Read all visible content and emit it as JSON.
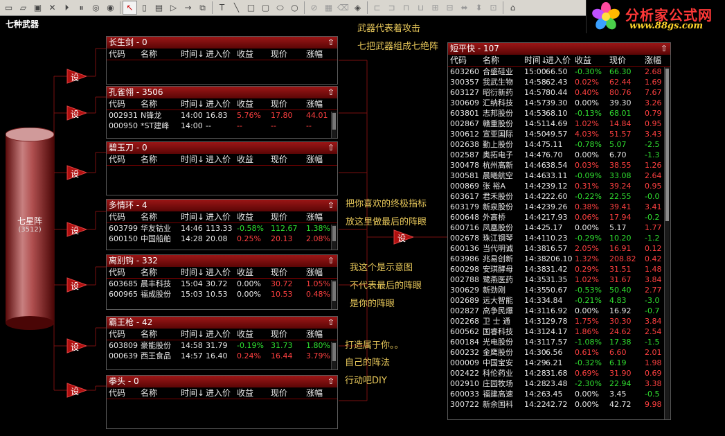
{
  "toolbar": {
    "icons": [
      "new-icon",
      "open-icon",
      "save-icon",
      "delete-icon",
      "play-icon",
      "pause-icon",
      "stop-icon",
      "record-icon",
      "select-arrow-icon",
      "rect-frame-icon",
      "note-icon",
      "triangle-icon",
      "arrow-line-icon",
      "copy-icon",
      "text-icon",
      "line-icon",
      "rectangle-icon",
      "rounded-rect-icon",
      "ellipse-icon",
      "circle-icon",
      "disabled-icon",
      "paste-icon",
      "trash-icon",
      "fill-icon",
      "align-left-icon",
      "align-right-icon",
      "align-top-icon",
      "align-bottom-icon",
      "align-center-icon",
      "distribute-icon",
      "same-width-icon",
      "same-height-icon",
      "same-size-icon",
      "layout-icon"
    ]
  },
  "logo": {
    "title": "分析家公式网",
    "url": "www.88gs.com"
  },
  "page_title": "七种武器",
  "cylinder": {
    "label": "七星阵",
    "count": "(3512)"
  },
  "set_label": "设",
  "columns": [
    "代码",
    "名称",
    "时间↓",
    "进入价",
    "收益",
    "现价",
    "涨幅"
  ],
  "panels": [
    {
      "title": "长生剑 - 0",
      "rows": []
    },
    {
      "title": "孔雀翎 - 3506",
      "rows": [
        {
          "code": "002931",
          "name": "N锋龙",
          "time": "14:00",
          "entry": "16.83",
          "gain": "5.76%",
          "price": "17.80",
          "change": "44.01"
        },
        {
          "code": "000950",
          "name": "*ST建峰",
          "time": "14:00",
          "entry": "--",
          "gain": "--",
          "price": "--",
          "change": "--"
        }
      ]
    },
    {
      "title": "碧玉刀 - 0",
      "rows": []
    },
    {
      "title": "多情环 - 4",
      "rows": [
        {
          "code": "603799",
          "name": "华友钴业",
          "time": "14:46",
          "entry": "113.33",
          "gain": "-0.58%",
          "price": "112.67",
          "change": "1.38%"
        },
        {
          "code": "600150",
          "name": "中国船舶",
          "time": "14:28",
          "entry": "20.08",
          "gain": "0.25%",
          "price": "20.13",
          "change": "2.08%"
        }
      ]
    },
    {
      "title": "离别钩 - 332",
      "rows": [
        {
          "code": "603685",
          "name": "晨丰科技",
          "time": "15:04",
          "entry": "30.72",
          "gain": "0.00%",
          "price": "30.72",
          "change": "1.05%"
        },
        {
          "code": "600965",
          "name": "福成股份",
          "time": "15:03",
          "entry": "10.53",
          "gain": "0.00%",
          "price": "10.53",
          "change": "0.48%"
        }
      ]
    },
    {
      "title": "霸王枪 - 42",
      "rows": [
        {
          "code": "603809",
          "name": "豪能股份",
          "time": "14:58",
          "entry": "31.79",
          "gain": "-0.19%",
          "price": "31.73",
          "change": "1.80%"
        },
        {
          "code": "000639",
          "name": "西王食品",
          "time": "14:57",
          "entry": "16.40",
          "gain": "0.24%",
          "price": "16.44",
          "change": "3.79%"
        }
      ]
    },
    {
      "title": "拳头 - 0",
      "rows": []
    }
  ],
  "annotations": {
    "a1": "武器代表着攻击",
    "a2": "七把武器组成七绝阵",
    "a3": "把你喜欢的终极指标",
    "a4": "放这里做最后的阵眼",
    "a5": "我这个是示意图",
    "a6": "不代表最后的阵眼",
    "a7": "是你的阵眼",
    "a8": "打造属于你。。",
    "a9": "自己的阵法",
    "a10": "行动吧DIY"
  },
  "bigpanel": {
    "title": "短平快 - 107",
    "columns": [
      "代码",
      "名称",
      "时间↓",
      "进入价",
      "收益",
      "现价",
      "涨幅"
    ],
    "rows": [
      {
        "code": "603260",
        "name": "合盛硅业",
        "time": "15:00",
        "entry": "66.50",
        "gain": "-0.30%",
        "price": "66.30",
        "change": "2.68"
      },
      {
        "code": "300357",
        "name": "我武生物",
        "time": "14:58",
        "entry": "62.43",
        "gain": "0.02%",
        "price": "62.44",
        "change": "1.69"
      },
      {
        "code": "603127",
        "name": "昭衍新药",
        "time": "14:57",
        "entry": "80.44",
        "gain": "0.40%",
        "price": "80.76",
        "change": "7.67"
      },
      {
        "code": "300609",
        "name": "汇纳科技",
        "time": "14:57",
        "entry": "39.30",
        "gain": "0.00%",
        "price": "39.30",
        "change": "3.26"
      },
      {
        "code": "603801",
        "name": "志邦股份",
        "time": "14:53",
        "entry": "68.10",
        "gain": "-0.13%",
        "price": "68.01",
        "change": "0.79"
      },
      {
        "code": "002867",
        "name": "赣重股份",
        "time": "14:51",
        "entry": "14.69",
        "gain": "1.02%",
        "price": "14.84",
        "change": "0.95"
      },
      {
        "code": "300612",
        "name": "宣亚国际",
        "time": "14:50",
        "entry": "49.57",
        "gain": "4.03%",
        "price": "51.57",
        "change": "3.43"
      },
      {
        "code": "002638",
        "name": "勤上股份",
        "time": "14:47",
        "entry": "5.11",
        "gain": "-0.78%",
        "price": "5.07",
        "change": "-2.5"
      },
      {
        "code": "002587",
        "name": "奥拓电子",
        "time": "14:47",
        "entry": "6.70",
        "gain": "0.00%",
        "price": "6.70",
        "change": "-1.3"
      },
      {
        "code": "300478",
        "name": "杭州高新",
        "time": "14:46",
        "entry": "38.54",
        "gain": "0.03%",
        "price": "38.55",
        "change": "1.26"
      },
      {
        "code": "300581",
        "name": "晨曦航空",
        "time": "14:46",
        "entry": "33.11",
        "gain": "-0.09%",
        "price": "33.08",
        "change": "2.64"
      },
      {
        "code": "000869",
        "name": "张 裕A",
        "time": "14:42",
        "entry": "39.12",
        "gain": "0.31%",
        "price": "39.24",
        "change": "0.95"
      },
      {
        "code": "603617",
        "name": "君禾股份",
        "time": "14:42",
        "entry": "22.60",
        "gain": "-0.22%",
        "price": "22.55",
        "change": "-0.0"
      },
      {
        "code": "603179",
        "name": "新泉股份",
        "time": "14:42",
        "entry": "39.26",
        "gain": "0.38%",
        "price": "39.41",
        "change": "3.41"
      },
      {
        "code": "600648",
        "name": "外高桥",
        "time": "14:42",
        "entry": "17.93",
        "gain": "0.06%",
        "price": "17.94",
        "change": "-0.2"
      },
      {
        "code": "600716",
        "name": "凤凰股份",
        "time": "14:42",
        "entry": "5.17",
        "gain": "0.00%",
        "price": "5.17",
        "change": "1.77"
      },
      {
        "code": "002678",
        "name": "珠江钢琴",
        "time": "14:41",
        "entry": "10.23",
        "gain": "-0.29%",
        "price": "10.20",
        "change": "-1.2"
      },
      {
        "code": "600136",
        "name": "当代明诚",
        "time": "14:38",
        "entry": "16.57",
        "gain": "2.05%",
        "price": "16.91",
        "change": "0.12"
      },
      {
        "code": "603986",
        "name": "兆易创新",
        "time": "14:38",
        "entry": "206.10",
        "gain": "1.32%",
        "price": "208.82",
        "change": "0.42"
      },
      {
        "code": "600298",
        "name": "安琪酵母",
        "time": "14:38",
        "entry": "31.42",
        "gain": "0.29%",
        "price": "31.51",
        "change": "1.48"
      },
      {
        "code": "002788",
        "name": "鹭燕医药",
        "time": "14:35",
        "entry": "31.35",
        "gain": "1.02%",
        "price": "31.67",
        "change": "3.84"
      },
      {
        "code": "300629",
        "name": "新劲刚",
        "time": "14:35",
        "entry": "50.67",
        "gain": "-0.53%",
        "price": "50.40",
        "change": "2.77"
      },
      {
        "code": "002689",
        "name": "远大智能",
        "time": "14:33",
        "entry": "4.84",
        "gain": "-0.21%",
        "price": "4.83",
        "change": "-3.0"
      },
      {
        "code": "002827",
        "name": "高争民爆",
        "time": "14:31",
        "entry": "16.92",
        "gain": "0.00%",
        "price": "16.92",
        "change": "-0.7"
      },
      {
        "code": "002268",
        "name": "卫 士 通",
        "time": "14:31",
        "entry": "29.78",
        "gain": "1.75%",
        "price": "30.30",
        "change": "3.84"
      },
      {
        "code": "600562",
        "name": "国睿科技",
        "time": "14:31",
        "entry": "24.17",
        "gain": "1.86%",
        "price": "24.62",
        "change": "2.54"
      },
      {
        "code": "600184",
        "name": "光电股份",
        "time": "14:31",
        "entry": "17.57",
        "gain": "-1.08%",
        "price": "17.38",
        "change": "-1.5"
      },
      {
        "code": "600232",
        "name": "金鹰股份",
        "time": "14:30",
        "entry": "6.56",
        "gain": "0.61%",
        "price": "6.60",
        "change": "2.01"
      },
      {
        "code": "000009",
        "name": "中国宝安",
        "time": "14:29",
        "entry": "6.21",
        "gain": "-0.32%",
        "price": "6.19",
        "change": "1.98"
      },
      {
        "code": "002422",
        "name": "科伦药业",
        "time": "14:28",
        "entry": "31.68",
        "gain": "0.69%",
        "price": "31.90",
        "change": "0.69"
      },
      {
        "code": "002910",
        "name": "庄园牧场",
        "time": "14:28",
        "entry": "23.48",
        "gain": "-2.30%",
        "price": "22.94",
        "change": "3.38"
      },
      {
        "code": "600033",
        "name": "福建高速",
        "time": "14:26",
        "entry": "3.45",
        "gain": "0.00%",
        "price": "3.45",
        "change": "-0.5"
      },
      {
        "code": "300722",
        "name": "新余国科",
        "time": "14:22",
        "entry": "42.72",
        "gain": "0.00%",
        "price": "42.72",
        "change": "9.98"
      }
    ]
  }
}
